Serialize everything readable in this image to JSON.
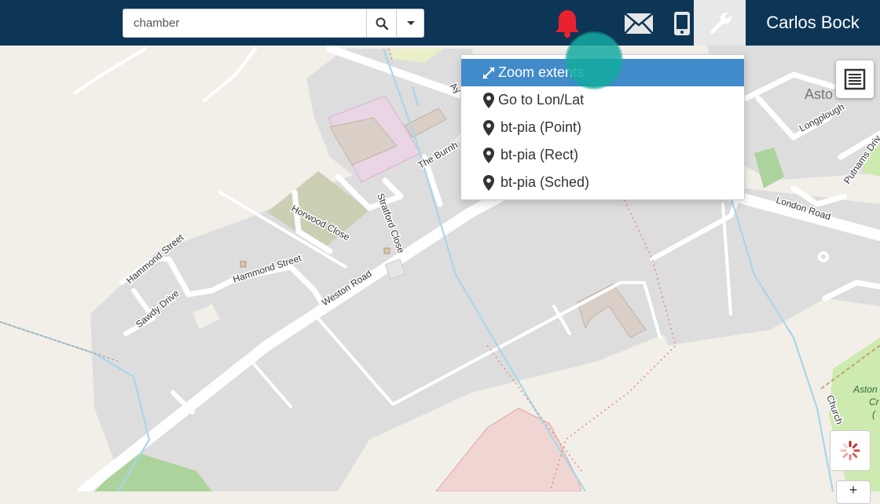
{
  "search": {
    "value": "chamber"
  },
  "header": {
    "username": "Carlos Bock"
  },
  "icons": {
    "search": "search-icon",
    "alerts": "bell-icon",
    "messages": "envelope-icon",
    "device": "mobile-phone-icon",
    "tools": "wrench-icon",
    "layers": "list-icon",
    "spinner": "loading-spinner-icon"
  },
  "colors": {
    "topbar": "#0d3556",
    "alert_bell": "#e8222e",
    "menu_active": "#428bca",
    "touch_indicator": "#14aaa0"
  },
  "menu": {
    "items": [
      {
        "label": "Zoom extents",
        "icon": "expand-arrows-icon",
        "active": true
      },
      {
        "label": "Go to Lon/Lat",
        "icon": "map-marker-icon"
      },
      {
        "label": "bt-pia (Point)",
        "icon": "map-marker-icon"
      },
      {
        "label": "bt-pia (Rect)",
        "icon": "map-marker-icon"
      },
      {
        "label": "bt-pia (Sched)",
        "icon": "map-marker-icon"
      }
    ]
  },
  "map_labels": {
    "the_burnham": "The Burnh",
    "ay": "Ay",
    "horwood_close": "Horwood Close",
    "stratford_close": "Stratford Close",
    "hammond_street_1": "Hammond Street",
    "hammond_street_2": "Hammond Street",
    "sawdy_drive": "Sawdy Drive",
    "weston_road": "Weston Road",
    "london_road": "London Road",
    "longplough": "Longplough",
    "putnams_drive": "Putnams Driv",
    "aston": "Asto",
    "aston_green_1": "Aston",
    "aston_green_2": "Cr",
    "aston_green_3": "(",
    "church": "Church"
  },
  "zoom": {
    "plus": "+"
  }
}
